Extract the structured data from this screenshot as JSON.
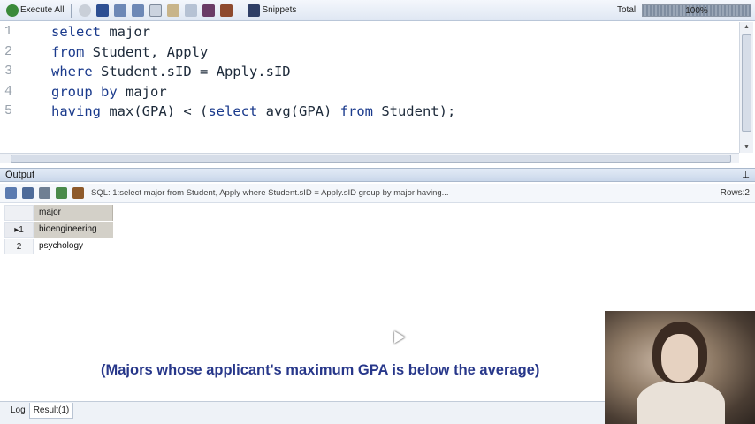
{
  "toolbar": {
    "execute_all_label": "Execute All",
    "snippets_label": "Snippets",
    "total_label": "Total:",
    "progress_text": "100%",
    "progress_fraction": 1.0
  },
  "editor": {
    "line_numbers": [
      "1",
      "2",
      "3",
      "4",
      "5"
    ]
  },
  "output": {
    "title": "Output",
    "sql_summary": "SQL: 1:select major  from Student, Apply  where Student.sID = Apply.sID  group by major  having...",
    "rows_label": "Rows:2",
    "grid": {
      "column_header": "major",
      "rows": [
        {
          "num": "1",
          "major": "bioengineering"
        },
        {
          "num": "2",
          "major": "psychology"
        }
      ]
    }
  },
  "caption": "(Majors whose applicant's maximum GPA is below the average)",
  "tabs": {
    "log": "Log",
    "result": "Result(1)"
  },
  "colors": {
    "keyword": "#1a3a8c",
    "caption": "#27378a",
    "selected_cell": "#d3d0c8"
  }
}
